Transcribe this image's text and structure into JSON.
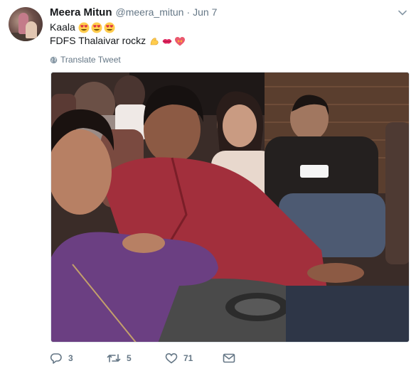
{
  "tweet": {
    "display_name": "Meera Mitun",
    "handle": "@meera_mitun",
    "separator": "·",
    "date": "Jun 7",
    "line1": "Kaala",
    "line2": "FDFS Thalaivar rockz",
    "translate_label": "Translate Tweet"
  },
  "actions": {
    "reply_count": "3",
    "retweet_count": "5",
    "like_count": "71"
  },
  "colors": {
    "text": "#14171a",
    "secondary": "#657786",
    "border": "#e1e8ed"
  }
}
